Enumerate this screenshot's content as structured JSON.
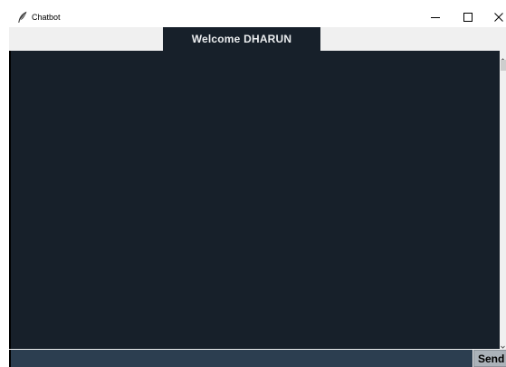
{
  "window": {
    "title": "Chatbot",
    "icon": "feather-icon",
    "controls": {
      "minimize": "minimize-icon",
      "maximize": "maximize-icon",
      "close": "close-icon"
    }
  },
  "header": {
    "welcome_text": "Welcome DHARUN"
  },
  "chat": {
    "messages": []
  },
  "input": {
    "value": "",
    "send_label": "Send"
  },
  "colors": {
    "background": "#17202A",
    "entry_background": "#2C3E50",
    "text": "#EAECEE",
    "send_button": "#ABB2B9"
  }
}
